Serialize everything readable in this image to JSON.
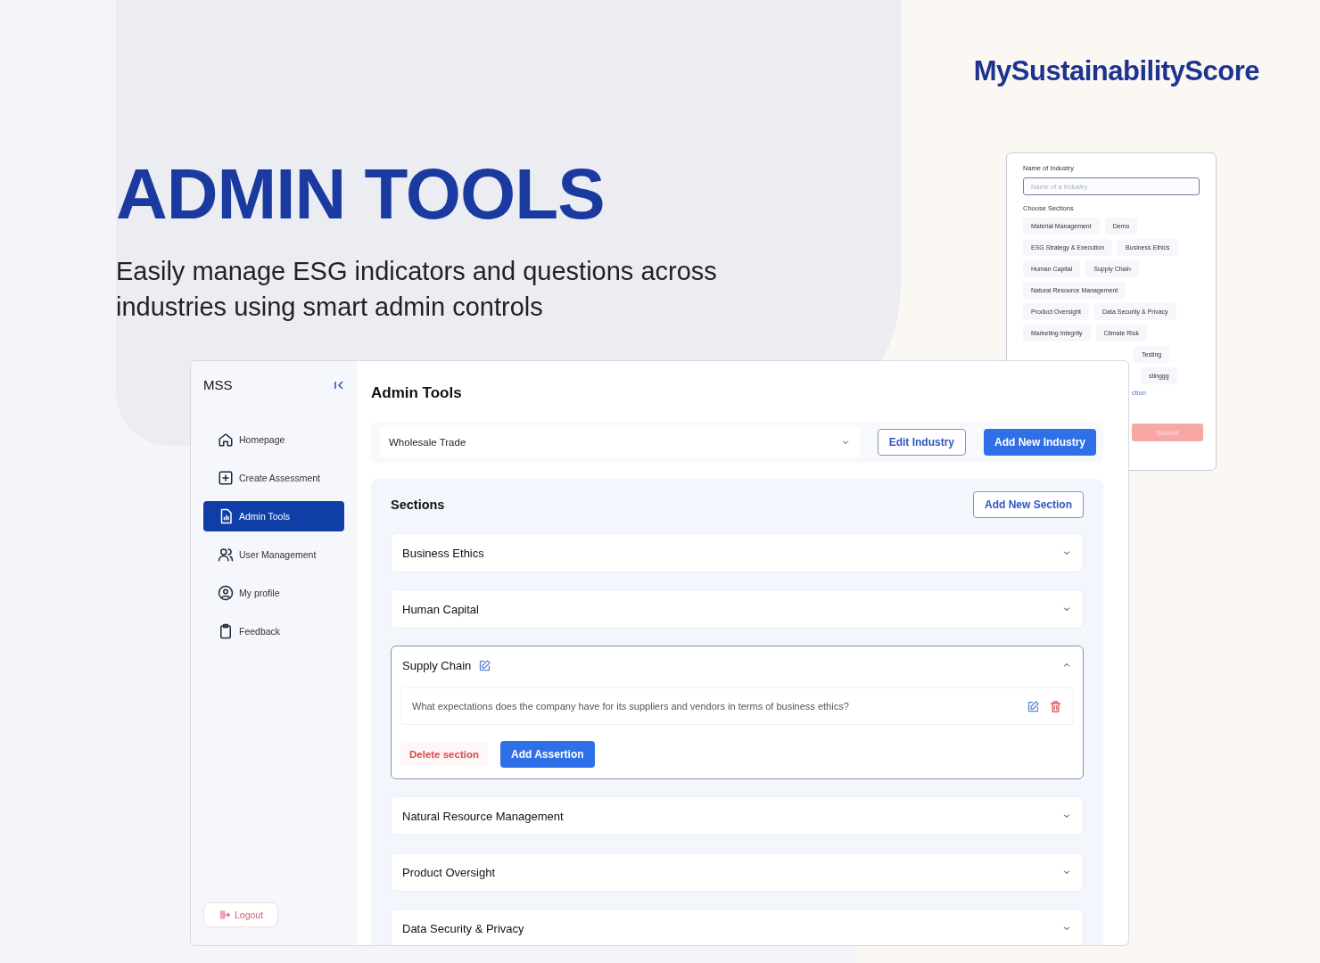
{
  "brand": {
    "logo": "MySustainabilityScore"
  },
  "hero": {
    "title": "ADMIN TOOLS",
    "subtitle": "Easily manage ESG indicators and questions across industries using smart admin controls"
  },
  "industry_form": {
    "name_label": "Name of Industry",
    "name_field": {
      "placeholder": "Name of a Industry"
    },
    "sections_label": "Choose Sections",
    "chip_rows": [
      [
        "Material Management",
        "Demo"
      ],
      [
        "ESG Strategy & Execution",
        "Business Ethics"
      ],
      [
        "Human Capital",
        "Supply Chain"
      ],
      [
        "Natural Resource Management"
      ],
      [
        "Product Oversight",
        "Data Security & Privacy"
      ],
      [
        "Marketing Integrity",
        "Climate Risk"
      ],
      [
        "Testing"
      ],
      [
        "stinggg"
      ]
    ],
    "link": "ction",
    "submit": "Submit"
  },
  "app": {
    "logo": "MSS",
    "nav": [
      {
        "label": "Homepage",
        "selected": false
      },
      {
        "label": "Create Assessment",
        "selected": false
      },
      {
        "label": "Admin Tools",
        "selected": true
      },
      {
        "label": "User Management",
        "selected": false
      },
      {
        "label": "My profile",
        "selected": false
      },
      {
        "label": "Feedback",
        "selected": false
      }
    ],
    "logout": "Logout",
    "title": "Admin Tools",
    "industry_select": {
      "value": "Wholesale Trade"
    },
    "edit_industry": "Edit Industry",
    "add_industry": "Add New Industry",
    "sections_title": "Sections",
    "add_section": "Add New Section",
    "sections": [
      {
        "title": "Business Ethics",
        "expanded": false
      },
      {
        "title": "Human Capital",
        "expanded": false
      },
      {
        "title": "Supply Chain",
        "expanded": true,
        "assertions": [
          "What expectations does the company have for its suppliers and vendors in terms of business ethics?"
        ],
        "delete_label": "Delete section",
        "add_label": "Add Assertion"
      },
      {
        "title": "Natural Resource Management",
        "expanded": false
      },
      {
        "title": "Product Oversight",
        "expanded": false
      },
      {
        "title": "Data Security & Privacy",
        "expanded": false
      }
    ]
  }
}
